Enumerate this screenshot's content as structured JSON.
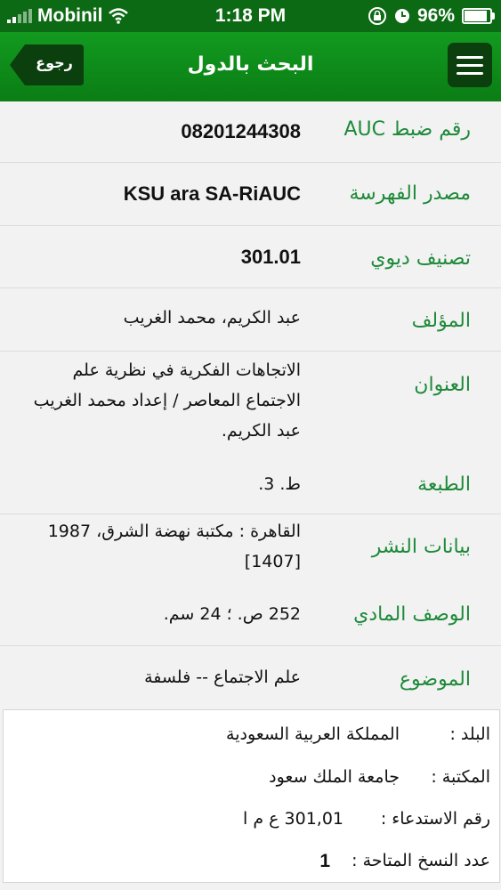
{
  "status_bar": {
    "carrier": "Mobinil",
    "time": "1:18 PM",
    "battery": "96%",
    "battery_level": 0.96,
    "icons": [
      "signal-icon",
      "wifi-icon",
      "rotation-lock-icon",
      "alarm-icon",
      "battery-icon"
    ]
  },
  "nav": {
    "back_label": "رجوع",
    "title": "البحث بالدول",
    "menu_icon": "hamburger-icon"
  },
  "record": [
    {
      "label": "رقم ضبط AUC",
      "value": "08201244308"
    },
    {
      "label": "مصدر الفهرسة",
      "value": "KSU ara SA-RiAUC"
    },
    {
      "label": "تصنيف ديوي",
      "value": "301.01"
    },
    {
      "label": "المؤلف",
      "value": "عبد الكريم، محمد الغريب"
    },
    {
      "label": "العنوان",
      "value": "الاتجاهات الفكرية في نظرية علم الاجتماع المعاصر / إعداد محمد الغريب عبد الكريم."
    },
    {
      "label": "الطبعة",
      "value": "ط. 3."
    },
    {
      "label": "بيانات النشر",
      "value": "القاهرة : مكتبة نهضة الشرق، 1987 [1407]"
    },
    {
      "label": "الوصف المادي",
      "value": "252 ص. ؛ 24 سم."
    },
    {
      "label": "الموضوع",
      "value": "علم الاجتماع -- فلسفة"
    }
  ],
  "holdings": {
    "country_label": "البلد :",
    "country": "المملكة العربية السعودية",
    "library_label": "المكتبة :",
    "library": "جامعة الملك سعود",
    "call_number_label": "رقم الاستدعاء :",
    "call_number": "301,01 ع م ا",
    "copies_label": "عدد النسخ المتاحة :",
    "copies": "1"
  },
  "colors": {
    "nav_green": "#129a1f",
    "label_green": "#1e8a3a",
    "menu_dark": "#0b3f0e"
  }
}
